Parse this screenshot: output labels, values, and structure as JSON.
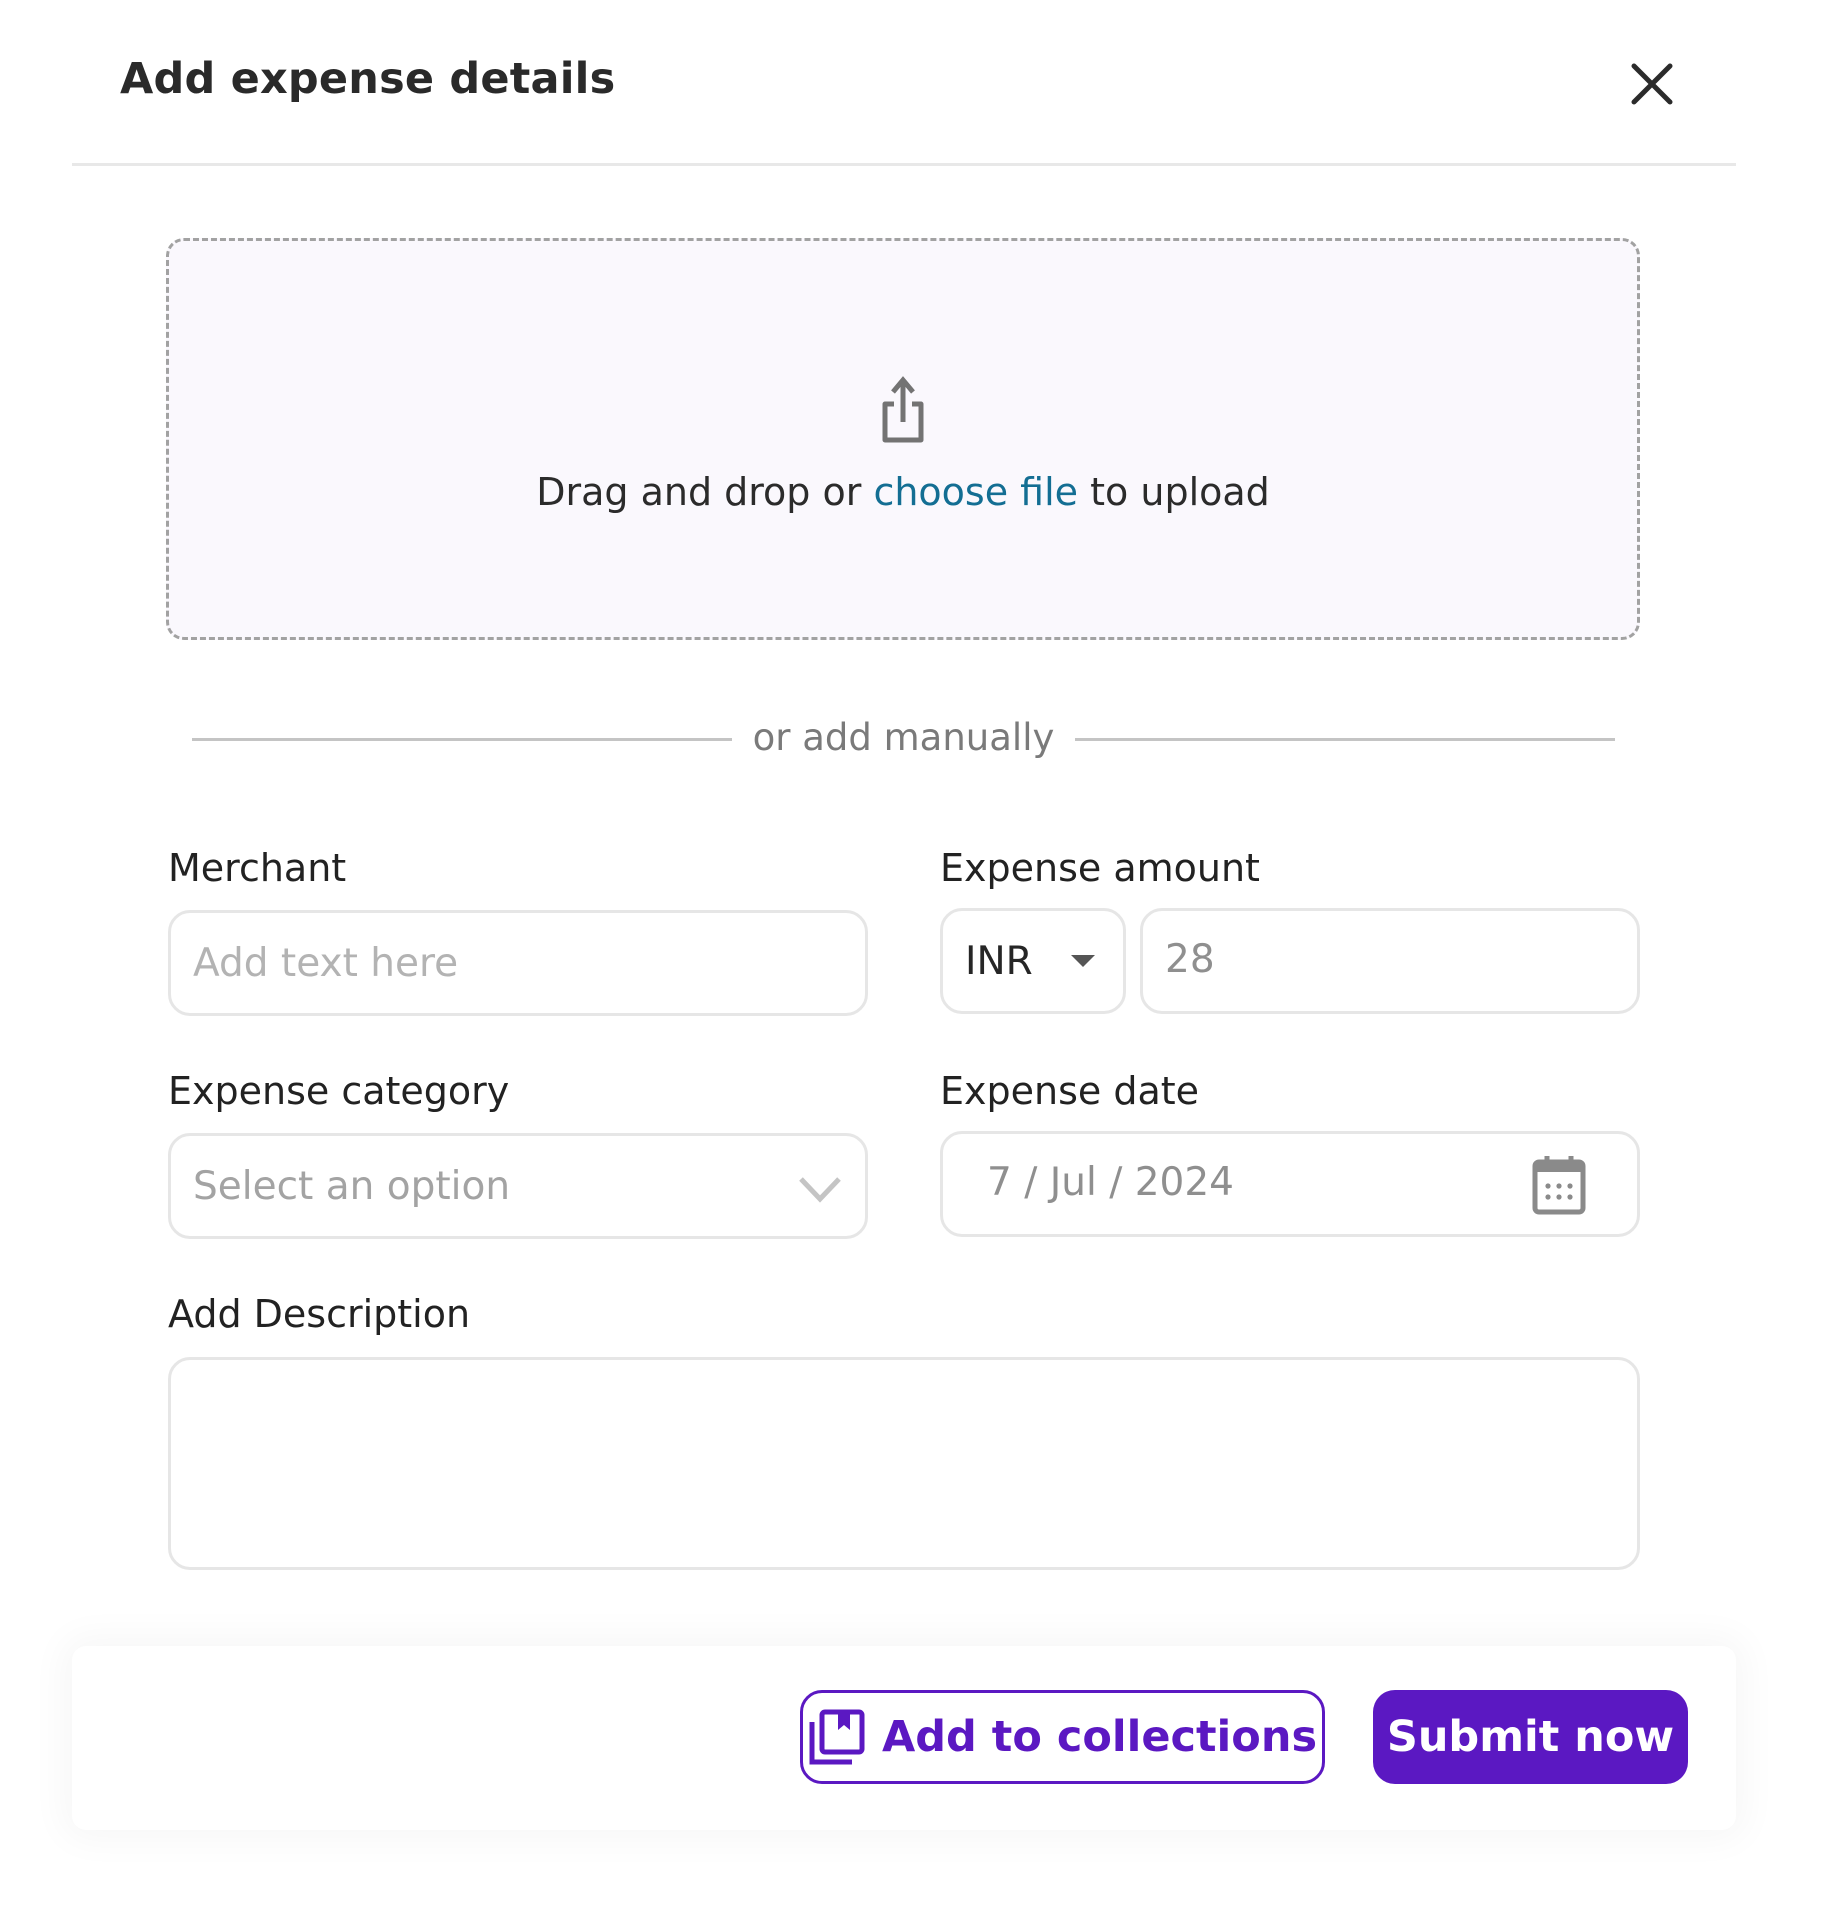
{
  "dialog": {
    "title": "Add expense details",
    "close_icon": "close-icon"
  },
  "upload": {
    "icon": "upload-share-icon",
    "text_before": "Drag and drop or ",
    "link_text": "choose file",
    "text_after": " to upload"
  },
  "separator": {
    "label": "or add manually"
  },
  "form": {
    "merchant": {
      "label": "Merchant",
      "placeholder": "Add text here",
      "value": ""
    },
    "amount": {
      "label": "Expense amount",
      "currency": "INR",
      "currency_icon": "caret-down-icon",
      "value": "28"
    },
    "category": {
      "label": "Expense category",
      "placeholder": "Select an option",
      "icon": "chevron-down-icon"
    },
    "date": {
      "label": "Expense date",
      "value": "7 / Jul / 2024",
      "icon": "calendar-icon"
    },
    "description": {
      "label": "Add Description",
      "value": ""
    }
  },
  "footer": {
    "collections_label": "Add to collections",
    "collections_icon": "collections-bookmark-icon",
    "submit_label": "Submit now"
  },
  "colors": {
    "primary": "#5b18c2",
    "link": "#136e93",
    "dropzone_bg": "#faf8fd",
    "border": "#e6e6e6"
  }
}
